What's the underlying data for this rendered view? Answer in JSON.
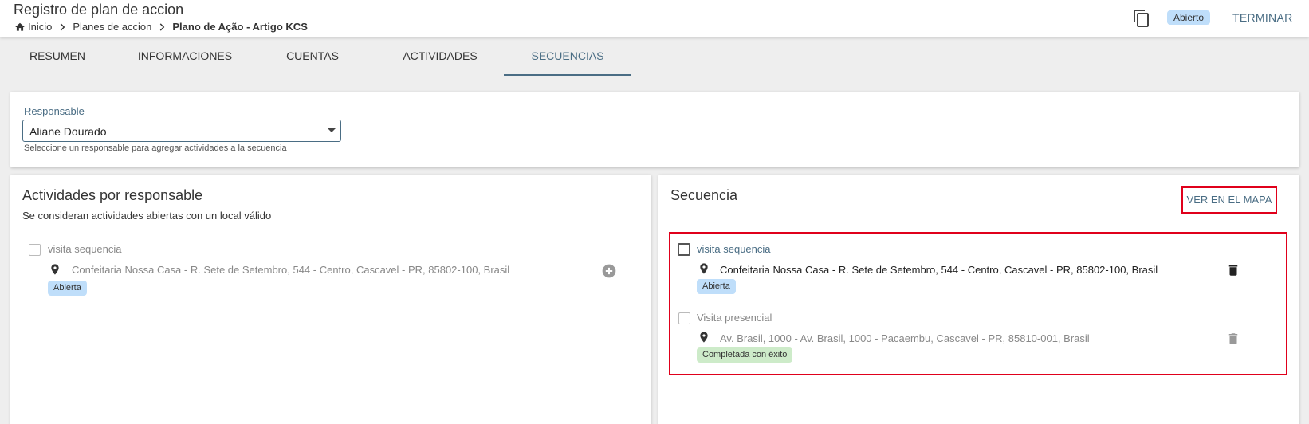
{
  "header": {
    "title": "Registro de plan de accion",
    "breadcrumb": [
      "Inicio",
      "Planes de accion",
      "Plano de Ação - Artigo KCS"
    ],
    "status": "Abierto",
    "finish_label": "TERMINAR"
  },
  "tabs": [
    {
      "label": "RESUMEN",
      "active": false
    },
    {
      "label": "INFORMACIONES",
      "active": false
    },
    {
      "label": "CUENTAS",
      "active": false
    },
    {
      "label": "ACTIVIDADES",
      "active": false
    },
    {
      "label": "SECUENCIAS",
      "active": true
    }
  ],
  "responsable": {
    "label": "Responsable",
    "value": "Aliane Dourado",
    "help": "Seleccione un responsable para agregar actividades a la secuencia"
  },
  "left_panel": {
    "title": "Actividades por responsable",
    "subtitle": "Se consideran actividades abiertas con un local válido",
    "items": [
      {
        "title": "visita sequencia",
        "address": "Confeitaria Nossa Casa - R. Sete de Setembro, 544 - Centro, Cascavel - PR, 85802-100, Brasil",
        "status": "Abierta"
      }
    ]
  },
  "right_panel": {
    "title": "Secuencia",
    "map_button": "VER EN EL MAPA",
    "items": [
      {
        "title": "visita sequencia",
        "address": "Confeitaria Nossa Casa - R. Sete de Setembro, 544 - Centro, Cascavel - PR, 85802-100, Brasil",
        "status": "Abierta"
      },
      {
        "title": "Visita presencial",
        "address": "Av. Brasil, 1000 - Av. Brasil, 1000 - Pacaembu, Cascavel - PR, 85810-001, Brasil",
        "status": "Completada con éxito"
      }
    ]
  },
  "colors": {
    "accent": "#4a6d84",
    "highlight_border": "#e0001b",
    "badge_open": "#bfdefa",
    "badge_done": "#cdebc9"
  }
}
